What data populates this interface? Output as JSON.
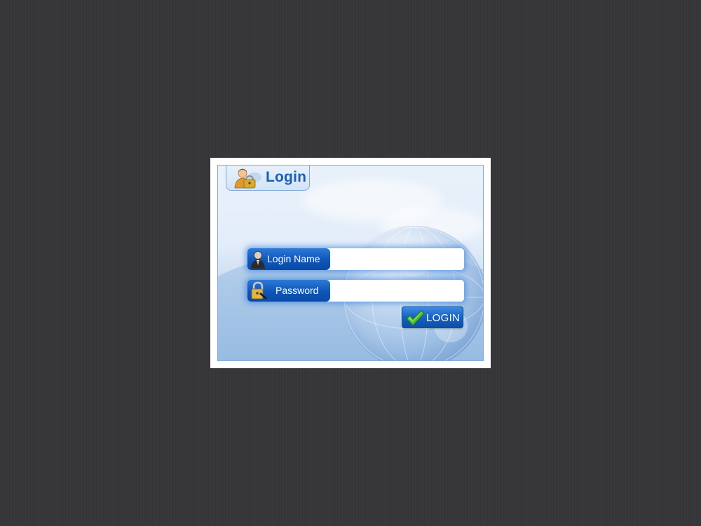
{
  "login_panel": {
    "title": "Login",
    "title_icon": "user-lock-icon",
    "login_name": {
      "label": "Login Name",
      "icon": "user-icon",
      "value": "",
      "placeholder": ""
    },
    "password": {
      "label": "Password",
      "icon": "padlock-icon",
      "value": "",
      "placeholder": ""
    },
    "submit": {
      "label": "LOGIN",
      "icon": "checkmark-icon"
    }
  },
  "colors": {
    "page_background": "#363638",
    "accent_blue": "#1a5fb4",
    "label_blue": "#0f55b8",
    "check_green": "#49b83a"
  }
}
